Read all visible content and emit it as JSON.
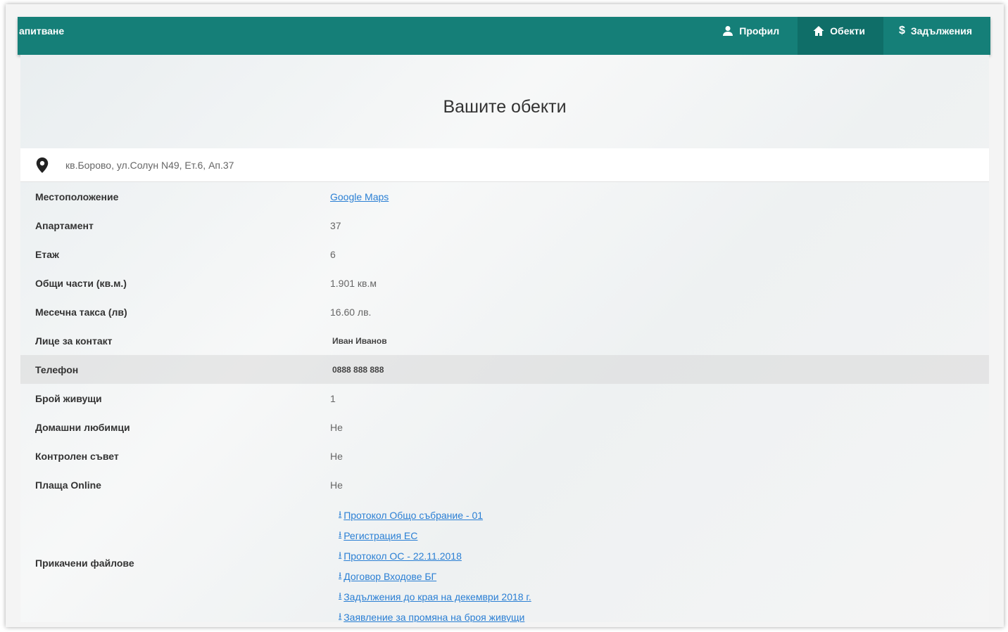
{
  "navbar": {
    "brand": "апитване",
    "items": [
      {
        "label": "Профил",
        "icon": "user-icon"
      },
      {
        "label": "Обекти",
        "icon": "home-icon"
      },
      {
        "label": "Задължения",
        "icon": "dollar-icon"
      }
    ],
    "dollar_symbol": "$",
    "active_item": "Обекти"
  },
  "page": {
    "title": "Вашите обекти",
    "address": "кв.Борово, ул.Солун N49, Ет.6, Ап.37"
  },
  "details": {
    "location_label": "Местоположение",
    "location_value": "Google Maps",
    "apartment_label": "Апартамент",
    "apartment_value": "37",
    "floor_label": "Етаж",
    "floor_value": "6",
    "common_parts_label": "Общи части (кв.м.)",
    "common_parts_value": "1.901 кв.м",
    "monthly_fee_label": "Месечна такса (лв)",
    "monthly_fee_value": "16.60 лв.",
    "contact_label": "Лице за контакт",
    "contact_value": "Иван Иванов",
    "phone_label": "Телефон",
    "phone_value": "0888 888 888",
    "residents_label": "Брой живущи",
    "residents_value": "1",
    "pets_label": "Домашни любимци",
    "pets_value": "Не",
    "control_board_label": "Контролен съвет",
    "control_board_value": "Не",
    "pays_online_label": "Плаща Online",
    "pays_online_value": "Не",
    "files_label": "Прикачени файлове",
    "files": [
      "Протокол Общо събрание - 01",
      "Регистрация ЕС",
      "Протокол ОС - 22.11.2018",
      "Договор Входове БГ",
      "Задължения до края на декември 2018 г.",
      "Заявление за промяна на броя живущи"
    ]
  },
  "colors": {
    "navbar": "#157f78",
    "navbar_active": "#0f6e68",
    "link": "#2a7fd4"
  }
}
